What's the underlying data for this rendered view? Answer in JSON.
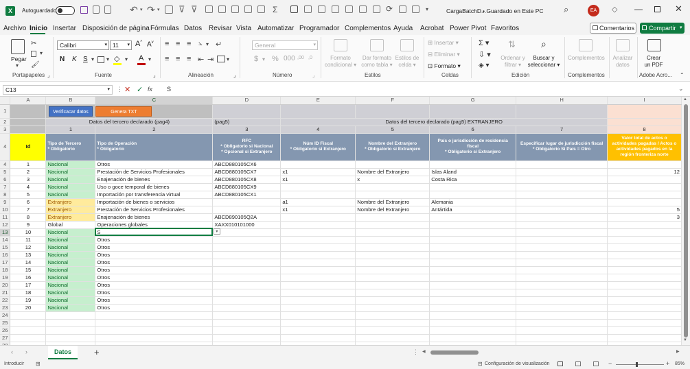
{
  "titlebar": {
    "autosave_label": "Autoguardado",
    "title": "CargaBatchD...",
    "save_status": "• Guardado en Este PC",
    "user_initials": "EA"
  },
  "menu": [
    "Archivo",
    "Inicio",
    "Insertar",
    "Disposición de página",
    "Fórmulas",
    "Datos",
    "Revisar",
    "Vista",
    "Automatizar",
    "Programador",
    "Complementos",
    "Ayuda",
    "Acrobat",
    "Power Pivot",
    "Favoritos"
  ],
  "menu_active": "Inicio",
  "comments_label": "Comentarios",
  "share_label": "Compartir",
  "ribbon": {
    "paste": "Pegar",
    "clipboard": "Portapapeles",
    "font_name": "Calibri",
    "font_size": "11",
    "bold": "N",
    "italic": "K",
    "underline": "S",
    "font": "Fuente",
    "alignment": "Alineación",
    "number_format": "General",
    "number": "Número",
    "cond_format_1": "Formato",
    "cond_format_2": "condicional",
    "format_table_1": "Dar formato",
    "format_table_2": "como tabla",
    "cell_styles_1": "Estilos de",
    "cell_styles_2": "celda",
    "styles": "Estilos",
    "insert": "Insertar",
    "delete": "Eliminar",
    "format": "Formato",
    "cells": "Celdas",
    "sort_1": "Ordenar y",
    "sort_2": "filtrar",
    "find_1": "Buscar y",
    "find_2": "seleccionar",
    "editing": "Edición",
    "addins": "Complementos",
    "addins_grp": "Complementos",
    "analyze_1": "Analizar",
    "analyze_2": "datos",
    "create_pdf_1": "Crear",
    "create_pdf_2": "un PDF",
    "acrobat_grp": "Adobe Acro..."
  },
  "formula_bar": {
    "name_box": "C13",
    "fx": "fx",
    "value": "S"
  },
  "columns": [
    "A",
    "B",
    "C",
    "D",
    "E",
    "F",
    "G",
    "H",
    "I"
  ],
  "buttons": {
    "verify": "Verificacar datos",
    "generate": "Genera TXT"
  },
  "row2": {
    "group_left": "Datos del tercero declarado (pag4)",
    "pag5": "(pag5)",
    "group_right": "Datos del tercero declarado (pag5) EXTRANJERO"
  },
  "row3": [
    "",
    "1",
    "2",
    "3",
    "4",
    "5",
    "6",
    "7",
    "8"
  ],
  "headers": [
    "Id",
    "Tipo de Tercero\n* Obligatorio",
    "Tipo de Operación\n* Obligatorio",
    "RFC\n* Obligatorio si Nacional\n* Opcional si Extranjero",
    "Núm ID Fiscal\n* Obligatorio si Extranjero",
    "Nombre del Extranjero\n* Obligatorio si Extranjero",
    "País o jurisdicción de residencia fiscal\n* Obligatorio si Extranjero",
    "Especificar lugar de jurisdicción fiscal\n* Obligatorio Si País = Otro",
    "Valor total de actos o actividades pagadas / Actos o actividades pagados en la región fronteriza norte"
  ],
  "rows": [
    {
      "n": "4",
      "id": "1",
      "tipo": "Nacional",
      "op": "Otros",
      "rfc": "ABCD880105CX6",
      "numid": "",
      "nombre": "",
      "pais": "",
      "lugar": "",
      "valor": ""
    },
    {
      "n": "5",
      "id": "2",
      "tipo": "Nacional",
      "op": "Prestación de Servicios Profesionales",
      "rfc": "ABCD880105CX7",
      "numid": "x1",
      "nombre": "Nombre del Extranjero",
      "pais": "Islas Aland",
      "lugar": "",
      "valor": "12"
    },
    {
      "n": "6",
      "id": "3",
      "tipo": "Nacional",
      "op": "Enajenación de bienes",
      "rfc": "ABCD880105CX8",
      "numid": "x1",
      "nombre": "x",
      "pais": "Costa Rica",
      "lugar": "",
      "valor": ""
    },
    {
      "n": "7",
      "id": "4",
      "tipo": "Nacional",
      "op": "Uso o goce temporal de bienes",
      "rfc": "ABCD880105CX9",
      "numid": "",
      "nombre": "",
      "pais": "",
      "lugar": "",
      "valor": ""
    },
    {
      "n": "8",
      "id": "5",
      "tipo": "Nacional",
      "op": "Importación por transferencia virtual",
      "rfc": "ABCD880105CX1",
      "numid": "",
      "nombre": "",
      "pais": "",
      "lugar": "",
      "valor": ""
    },
    {
      "n": "9",
      "id": "6",
      "tipo": "Extranjero",
      "op": "Importación de bienes o servicios",
      "rfc": "",
      "numid": "a1",
      "nombre": "Nombre del Extranjero",
      "pais": "Alemania",
      "lugar": "",
      "valor": ""
    },
    {
      "n": "10",
      "id": "7",
      "tipo": "Extranjero",
      "op": "Prestación de Servicios Profesionales",
      "rfc": "",
      "numid": "x1",
      "nombre": "Nombre del Extranjero",
      "pais": "Antártida",
      "lugar": "",
      "valor": "5"
    },
    {
      "n": "11",
      "id": "8",
      "tipo": "Extranjero",
      "op": "Enajenación de bienes",
      "rfc": "ABCD890105Q2A",
      "numid": "",
      "nombre": "",
      "pais": "",
      "lugar": "",
      "valor": "3"
    },
    {
      "n": "12",
      "id": "9",
      "tipo": "Global",
      "op": "Operaciones globales",
      "rfc": "XAXX010101000",
      "numid": "",
      "nombre": "",
      "pais": "",
      "lugar": "",
      "valor": ""
    },
    {
      "n": "13",
      "id": "10",
      "tipo": "Nacional",
      "op": "S",
      "rfc": "",
      "numid": "",
      "nombre": "",
      "pais": "",
      "lugar": "",
      "valor": ""
    },
    {
      "n": "14",
      "id": "11",
      "tipo": "Nacional",
      "op": "Otros",
      "rfc": "",
      "numid": "",
      "nombre": "",
      "pais": "",
      "lugar": "",
      "valor": ""
    },
    {
      "n": "15",
      "id": "12",
      "tipo": "Nacional",
      "op": "Otros",
      "rfc": "",
      "numid": "",
      "nombre": "",
      "pais": "",
      "lugar": "",
      "valor": ""
    },
    {
      "n": "16",
      "id": "13",
      "tipo": "Nacional",
      "op": "Otros",
      "rfc": "",
      "numid": "",
      "nombre": "",
      "pais": "",
      "lugar": "",
      "valor": ""
    },
    {
      "n": "17",
      "id": "14",
      "tipo": "Nacional",
      "op": "Otros",
      "rfc": "",
      "numid": "",
      "nombre": "",
      "pais": "",
      "lugar": "",
      "valor": ""
    },
    {
      "n": "18",
      "id": "15",
      "tipo": "Nacional",
      "op": "Otros",
      "rfc": "",
      "numid": "",
      "nombre": "",
      "pais": "",
      "lugar": "",
      "valor": ""
    },
    {
      "n": "19",
      "id": "16",
      "tipo": "Nacional",
      "op": "Otros",
      "rfc": "",
      "numid": "",
      "nombre": "",
      "pais": "",
      "lugar": "",
      "valor": ""
    },
    {
      "n": "20",
      "id": "17",
      "tipo": "Nacional",
      "op": "Otros",
      "rfc": "",
      "numid": "",
      "nombre": "",
      "pais": "",
      "lugar": "",
      "valor": ""
    },
    {
      "n": "21",
      "id": "18",
      "tipo": "Nacional",
      "op": "Otros",
      "rfc": "",
      "numid": "",
      "nombre": "",
      "pais": "",
      "lugar": "",
      "valor": ""
    },
    {
      "n": "22",
      "id": "19",
      "tipo": "Nacional",
      "op": "Otros",
      "rfc": "",
      "numid": "",
      "nombre": "",
      "pais": "",
      "lugar": "",
      "valor": ""
    },
    {
      "n": "23",
      "id": "20",
      "tipo": "Nacional",
      "op": "Otros",
      "rfc": "",
      "numid": "",
      "nombre": "",
      "pais": "",
      "lugar": "",
      "valor": ""
    }
  ],
  "empty_rows": [
    "24",
    "25",
    "26",
    "27",
    "28",
    "29"
  ],
  "sheet_tab": "Datos",
  "status": {
    "mode": "Introducir",
    "display_settings": "Configuración de visualización",
    "zoom": "85%"
  },
  "colors": {
    "excel_green": "#107c41",
    "header_blue": "#8497b0",
    "yellow": "#ffff00",
    "orange": "#ffc000",
    "nacional_green": "#c6efce",
    "extranjero_tan": "#ffeb9c"
  }
}
